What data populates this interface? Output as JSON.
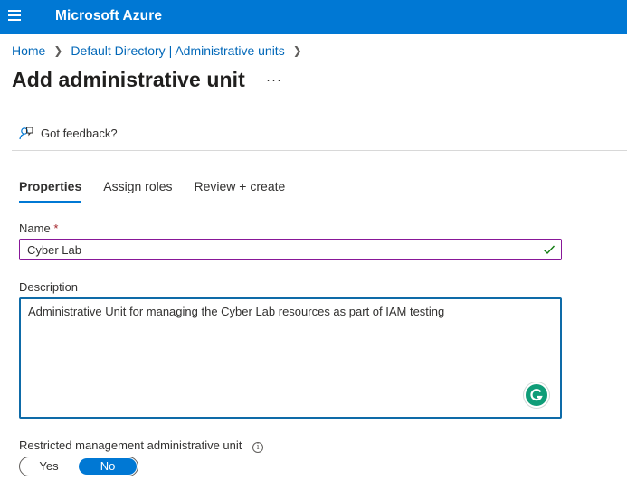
{
  "header": {
    "brand": "Microsoft Azure",
    "menu_icon": "hamburger-menu-icon"
  },
  "breadcrumb": {
    "items": [
      "Home",
      "Default Directory | Administrative units"
    ]
  },
  "page": {
    "title": "Add administrative unit",
    "more_label": "···"
  },
  "feedback": {
    "label": "Got feedback?",
    "icon": "feedback-person-icon"
  },
  "tabs": [
    {
      "label": "Properties",
      "active": true
    },
    {
      "label": "Assign roles",
      "active": false
    },
    {
      "label": "Review + create",
      "active": false
    }
  ],
  "form": {
    "name_label": "Name",
    "required_mark": "*",
    "name_value": "Cyber Lab",
    "description_label": "Description",
    "description_value": "Administrative Unit for managing the Cyber Lab resources as part of IAM testing",
    "restricted_label": "Restricted management administrative unit",
    "info_icon_glyph": "i",
    "toggle_yes": "Yes",
    "toggle_no": "No",
    "toggle_selected": "No"
  },
  "colors": {
    "accent": "#0078d4",
    "valid": "#107c10",
    "name_border": "#881798"
  }
}
